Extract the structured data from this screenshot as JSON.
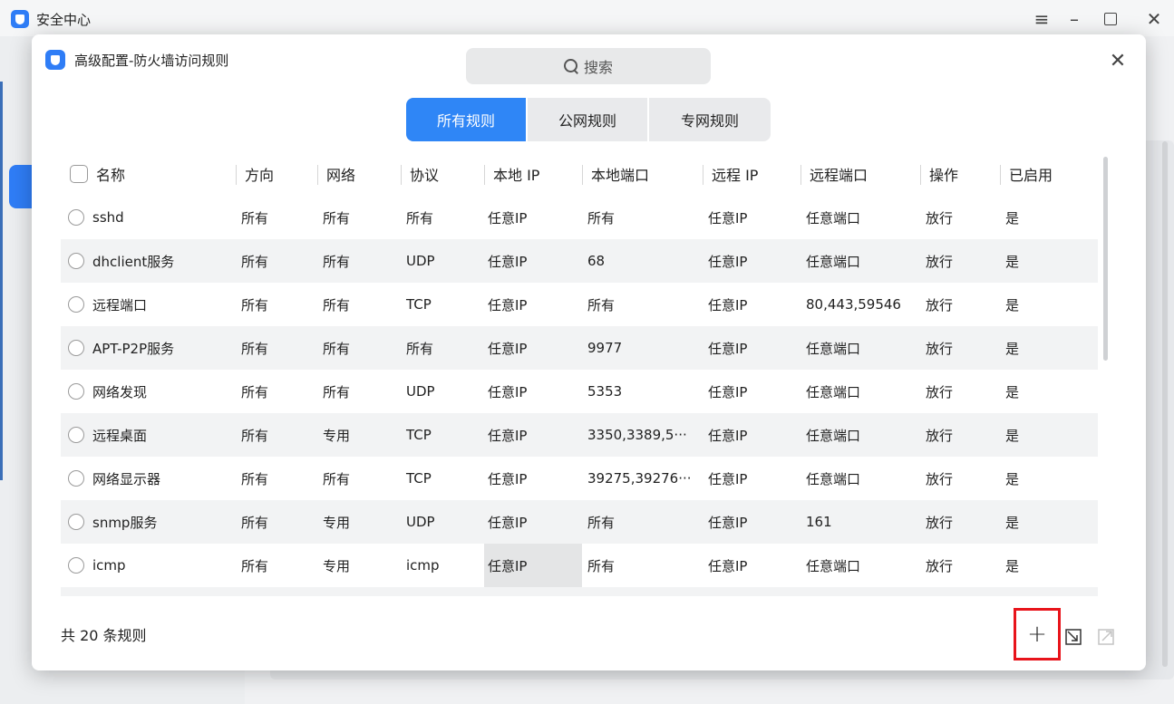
{
  "app": {
    "title": "安全中心"
  },
  "dialog": {
    "title": "高级配置-防火墙访问规则"
  },
  "search": {
    "placeholder": "搜索"
  },
  "tabs": [
    {
      "label": "所有规则",
      "active": true
    },
    {
      "label": "公网规则",
      "active": false
    },
    {
      "label": "专网规则",
      "active": false
    }
  ],
  "table": {
    "headers": [
      "名称",
      "方向",
      "网络",
      "协议",
      "本地 IP",
      "本地端口",
      "远程 IP",
      "远程端口",
      "操作",
      "已启用"
    ],
    "rows": [
      [
        "sshd",
        "所有",
        "所有",
        "所有",
        "任意IP",
        "所有",
        "任意IP",
        "任意端口",
        "放行",
        "是"
      ],
      [
        "dhclient服务",
        "所有",
        "所有",
        "UDP",
        "任意IP",
        "68",
        "任意IP",
        "任意端口",
        "放行",
        "是"
      ],
      [
        "远程端口",
        "所有",
        "所有",
        "TCP",
        "任意IP",
        "所有",
        "任意IP",
        "80,443,59546",
        "放行",
        "是"
      ],
      [
        "APT-P2P服务",
        "所有",
        "所有",
        "所有",
        "任意IP",
        "9977",
        "任意IP",
        "任意端口",
        "放行",
        "是"
      ],
      [
        "网络发现",
        "所有",
        "所有",
        "UDP",
        "任意IP",
        "5353",
        "任意IP",
        "任意端口",
        "放行",
        "是"
      ],
      [
        "远程桌面",
        "所有",
        "专用",
        "TCP",
        "任意IP",
        "3350,3389,5···",
        "任意IP",
        "任意端口",
        "放行",
        "是"
      ],
      [
        "网络显示器",
        "所有",
        "所有",
        "TCP",
        "任意IP",
        "39275,39276···",
        "任意IP",
        "任意端口",
        "放行",
        "是"
      ],
      [
        "snmp服务",
        "所有",
        "专用",
        "UDP",
        "任意IP",
        "所有",
        "任意IP",
        "161",
        "放行",
        "是"
      ],
      [
        "icmp",
        "所有",
        "专用",
        "icmp",
        "任意IP",
        "所有",
        "任意IP",
        "任意端口",
        "放行",
        "是"
      ]
    ]
  },
  "footer": {
    "count_label": "共 20 条规则"
  },
  "actions": {
    "add_label": "+"
  },
  "colors": {
    "accent": "#2f86f6",
    "highlight_box": "#e8141b"
  }
}
